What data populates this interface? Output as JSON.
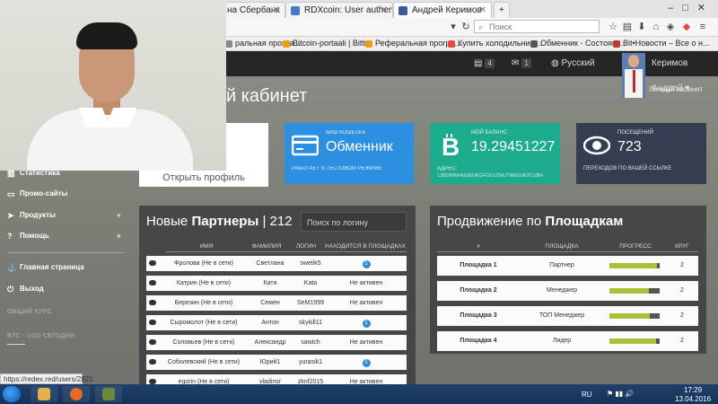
{
  "browser": {
    "tabs": [
      {
        "title": "на Сбербанк",
        "color": "#2d9a4a"
      },
      {
        "title": "RDXcoin: User authenticati...",
        "color": "#4a78c8"
      },
      {
        "title": "Андрей Керимов",
        "color": "#3b5998"
      }
    ],
    "search_placeholder": "Поиск",
    "bookmarks": [
      {
        "label": "ральная програ...",
        "color": "#888"
      },
      {
        "label": "Bitcoin-portaali | Bitti...",
        "color": "#f39c12"
      },
      {
        "label": "Реферальная програ...",
        "color": "#f39c12"
      },
      {
        "label": "Купить холодильник ...",
        "color": "#e74c3c"
      },
      {
        "label": "Обменник - Состоян...",
        "color": "#555"
      },
      {
        "label": "Bit•Новости – Все о н...",
        "color": "#c0392b"
      }
    ],
    "status_url": "https://redex.red/users/2821"
  },
  "header": {
    "messages_count": "4",
    "mail_count": "1",
    "language": "Русский",
    "user_name": "Керимов Андрей",
    "breadcrumb": "Личный кабинет"
  },
  "page": {
    "title": "й кабинет"
  },
  "sidebar": {
    "items": [
      {
        "label": "Статистика",
        "icon": "chart-icon"
      },
      {
        "label": "Промо-сайты",
        "icon": "monitor-icon"
      },
      {
        "label": "Продукты",
        "icon": "send-icon"
      },
      {
        "label": "Помощь",
        "icon": "question-icon"
      },
      {
        "label": "Главная страница",
        "icon": "link-icon"
      },
      {
        "label": "Выход",
        "icon": "power-icon"
      }
    ],
    "muted_label": "ОБЩИЙ КУРС",
    "rate_label": "BTC - USD СЕГОДНЯ"
  },
  "profile": {
    "button": "Открыть профиль"
  },
  "stats": {
    "wallet": {
      "label": "ВАШ КОШЕЛЕК",
      "value": "Обменник",
      "sub": "РАБОТАЕТ В ТЕСТОВОМ РЕЖИМЕ",
      "color": "#2d8fe0"
    },
    "balance": {
      "label": "МОЙ БАЛАНС",
      "value": "19.29451227",
      "sub": "АДРЕС:",
      "address": "1JNDNWHNGBUKGFCEUZNUTN6GUR7CUBH",
      "color": "#1dab8d"
    },
    "visits": {
      "label": "ПОСЕЩЕНИЙ",
      "value": "723",
      "sub": "ПЕРЕХОДОВ ПО ВАШЕЙ ССЫЛКЕ",
      "color": "#353d50"
    }
  },
  "partners": {
    "title_prefix": "Новые",
    "title_bold": "Партнеры",
    "title_count": "| 212",
    "search_placeholder": "Поиск по логину",
    "columns": [
      "ИМЯ",
      "ФАМИЛИЯ",
      "ЛОГИН",
      "НАХОДИТСЯ В ПЛОЩАДКАХ"
    ],
    "rows": [
      {
        "name": "Фролова (Не в сети)",
        "surname": "Светлана",
        "login": "swetik5",
        "status": "1"
      },
      {
        "name": "Катрин (Не в сети)",
        "surname": "Катя",
        "login": "Kata",
        "status": "Не активен"
      },
      {
        "name": "Березин (Не в сети)",
        "surname": "Семен",
        "login": "SeM1999",
        "status": "Не активен"
      },
      {
        "name": "Сыромолот (Не в сети)",
        "surname": "Антон",
        "login": "skykill11",
        "status": "1"
      },
      {
        "name": "Соловьев (Не в сети)",
        "surname": "Александр",
        "login": "sawich",
        "status": "Не активен"
      },
      {
        "name": "Соболевский (Не в сети)",
        "surname": "Юрий1",
        "login": "yurasik1",
        "status": "1"
      },
      {
        "name": "egorin (Не в сети)",
        "surname": "vladimir",
        "login": "zknf2015",
        "status": "Не активен"
      }
    ]
  },
  "promotion": {
    "title_prefix": "Продвижение по",
    "title_bold": "Площадкам",
    "columns": [
      "#",
      "ПЛОЩАДКА",
      "ПРОГРЕСС",
      "КРУГ"
    ],
    "rows": [
      {
        "site": "Площадка 1",
        "level": "Партнер",
        "progress": 0.95,
        "round": "2"
      },
      {
        "site": "Площадка 2",
        "level": "Менеджер",
        "progress": 0.78,
        "round": "2"
      },
      {
        "site": "Площадка 3",
        "level": "ТОП Менеджер",
        "progress": 0.8,
        "round": "2"
      },
      {
        "site": "Площадка 4",
        "level": "Лидер",
        "progress": 0.92,
        "round": "2"
      }
    ],
    "progress_color": "#a7c23a"
  },
  "taskbar": {
    "lang": "RU",
    "time": "17:29",
    "date": "13.04.2016"
  }
}
